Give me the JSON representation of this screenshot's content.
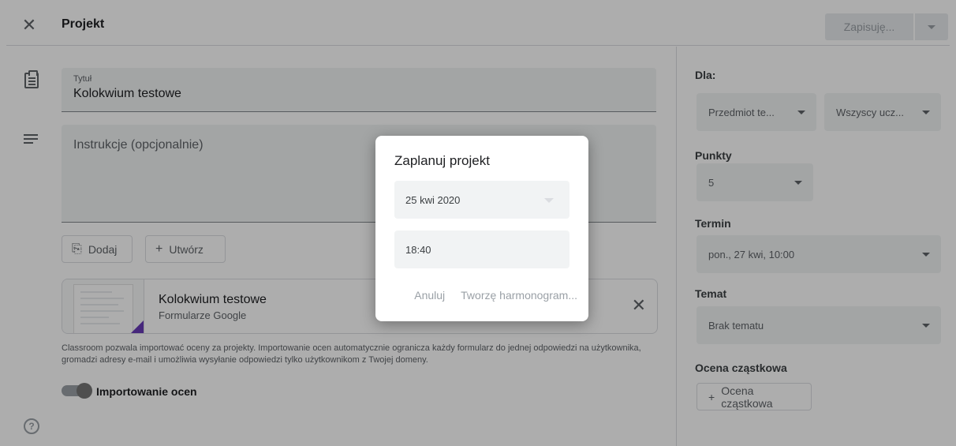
{
  "header": {
    "title": "Projekt",
    "save_label": "Zapisuję..."
  },
  "form": {
    "title_label": "Tytuł",
    "title_value": "Kolokwium testowe",
    "instructions_placeholder": "Instrukcje (opcjonalnie)",
    "add_label": "Dodaj",
    "create_label": "Utwórz",
    "attachment": {
      "title": "Kolokwium testowe",
      "subtitle": "Formularze Google"
    },
    "info_text": "Classroom pozwala importować oceny za projekty. Importowanie ocen automatycznie ogranicza każdy formularz do jednej odpowiedzi na użytkownika, gromadzi adresy e-mail i umożliwia wysyłanie odpowiedzi tylko użytkownikom z Twojej domeny.",
    "import_toggle_label": "Importowanie ocen",
    "import_toggle_on": true
  },
  "sidebar": {
    "for_label": "Dla:",
    "subject_value": "Przedmiot te...",
    "students_value": "Wszyscy ucz...",
    "points_label": "Punkty",
    "points_value": "5",
    "due_label": "Termin",
    "due_value": "pon., 27 kwi, 10:00",
    "topic_label": "Temat",
    "topic_value": "Brak tematu",
    "rubric_label": "Ocena cząstkowa",
    "rubric_button": "Ocena cząstkowa"
  },
  "dialog": {
    "title": "Zaplanuj projekt",
    "date_value": "25 kwi 2020",
    "time_value": "18:40",
    "cancel_label": "Anuluj",
    "schedule_label": "Tworzę harmonogram..."
  },
  "icons": {
    "close": "close-icon",
    "assignment": "assignment-icon",
    "notes": "notes-icon",
    "paperclip": "paperclip-icon",
    "plus": "plus-icon",
    "help": "help-icon",
    "dropdown": "chevron-down-icon"
  },
  "colors": {
    "forms_accent": "#673ab7",
    "scrim": "rgba(0,0,0,0.32)"
  }
}
